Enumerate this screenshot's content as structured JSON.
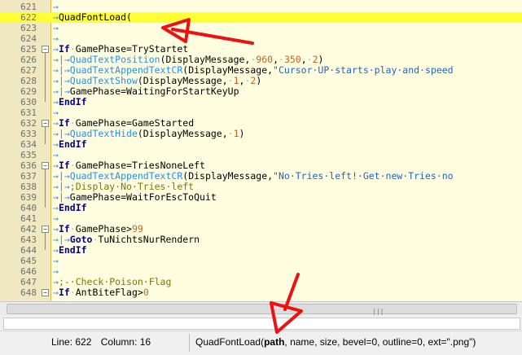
{
  "editor": {
    "current_line": 622,
    "lines": [
      {
        "num": "621",
        "tokens": [
          [
            "arrow",
            "→"
          ]
        ]
      },
      {
        "num": "622",
        "tokens": [
          [
            "arrow",
            "→"
          ],
          [
            "plain",
            "QuadFontLoad("
          ]
        ]
      },
      {
        "num": "623",
        "tokens": [
          [
            "arrow",
            "→"
          ]
        ]
      },
      {
        "num": "624",
        "tokens": [
          [
            "arrow",
            "→"
          ]
        ]
      },
      {
        "num": "625",
        "fold": "−",
        "tokens": [
          [
            "arrow",
            "→"
          ],
          [
            "kw",
            "If"
          ],
          [
            "dot",
            "·"
          ],
          [
            "plain",
            "GamePhase=TryStartet"
          ]
        ]
      },
      {
        "num": "626",
        "tokens": [
          [
            "arrow",
            "→|→"
          ],
          [
            "func",
            "QuadTextPosition"
          ],
          [
            "plain",
            "(DisplayMessage,"
          ],
          [
            "dot",
            "·"
          ],
          [
            "num",
            "960"
          ],
          [
            "plain",
            ","
          ],
          [
            "dot",
            "·"
          ],
          [
            "num",
            "350"
          ],
          [
            "plain",
            ","
          ],
          [
            "dot",
            "·"
          ],
          [
            "num",
            "2"
          ],
          [
            "plain",
            ")"
          ]
        ]
      },
      {
        "num": "627",
        "tokens": [
          [
            "arrow",
            "→|→"
          ],
          [
            "func",
            "QuadTextAppendTextCR"
          ],
          [
            "plain",
            "(DisplayMessage,"
          ],
          [
            "str",
            "\"Cursor·UP·starts·play·and·speed"
          ]
        ]
      },
      {
        "num": "628",
        "tokens": [
          [
            "arrow",
            "→|→"
          ],
          [
            "func",
            "QuadTextShow"
          ],
          [
            "plain",
            "(DisplayMessage,"
          ],
          [
            "dot",
            "·"
          ],
          [
            "num",
            "1"
          ],
          [
            "plain",
            ","
          ],
          [
            "dot",
            "·"
          ],
          [
            "num",
            "2"
          ],
          [
            "plain",
            ")"
          ]
        ]
      },
      {
        "num": "629",
        "tokens": [
          [
            "arrow",
            "→|→"
          ],
          [
            "plain",
            "GamePhase=WaitingForStartKeyUp"
          ]
        ]
      },
      {
        "num": "630",
        "tokens": [
          [
            "arrow",
            "→"
          ],
          [
            "kw",
            "EndIf"
          ]
        ]
      },
      {
        "num": "631",
        "tokens": [
          [
            "arrow",
            "→"
          ]
        ]
      },
      {
        "num": "632",
        "fold": "−",
        "tokens": [
          [
            "arrow",
            "→"
          ],
          [
            "kw",
            "If"
          ],
          [
            "dot",
            "·"
          ],
          [
            "plain",
            "GamePhase=GameStarted"
          ]
        ]
      },
      {
        "num": "633",
        "tokens": [
          [
            "arrow",
            "→|→"
          ],
          [
            "func",
            "QuadTextHide"
          ],
          [
            "plain",
            "(DisplayMessage,"
          ],
          [
            "dot",
            "·"
          ],
          [
            "num",
            "1"
          ],
          [
            "plain",
            ")"
          ]
        ]
      },
      {
        "num": "634",
        "tokens": [
          [
            "arrow",
            "→"
          ],
          [
            "kw",
            "EndIf"
          ]
        ]
      },
      {
        "num": "635",
        "tokens": [
          [
            "arrow",
            "→"
          ]
        ]
      },
      {
        "num": "636",
        "fold": "−",
        "tokens": [
          [
            "arrow",
            "→"
          ],
          [
            "kw",
            "If"
          ],
          [
            "dot",
            "·"
          ],
          [
            "plain",
            "GamePhase=TriesNoneLeft"
          ]
        ]
      },
      {
        "num": "637",
        "tokens": [
          [
            "arrow",
            "→|→"
          ],
          [
            "func",
            "QuadTextAppendTextCR"
          ],
          [
            "plain",
            "(DisplayMessage,"
          ],
          [
            "str",
            "\"No·Tries·left!·Get·new·Tries·no"
          ]
        ]
      },
      {
        "num": "638",
        "tokens": [
          [
            "arrow",
            "→|→"
          ],
          [
            "comment",
            ";Display·No·Tries·left"
          ]
        ]
      },
      {
        "num": "639",
        "tokens": [
          [
            "arrow",
            "→|→"
          ],
          [
            "plain",
            "GamePhase=WaitForEscToQuit"
          ]
        ]
      },
      {
        "num": "640",
        "tokens": [
          [
            "arrow",
            "→"
          ],
          [
            "kw",
            "EndIf"
          ]
        ]
      },
      {
        "num": "641",
        "tokens": [
          [
            "arrow",
            "→"
          ]
        ]
      },
      {
        "num": "642",
        "fold": "−",
        "tokens": [
          [
            "arrow",
            "→"
          ],
          [
            "kw",
            "If"
          ],
          [
            "dot",
            "·"
          ],
          [
            "plain",
            "GamePhase>"
          ],
          [
            "num",
            "99"
          ]
        ]
      },
      {
        "num": "643",
        "tokens": [
          [
            "arrow",
            "→|→"
          ],
          [
            "kw",
            "Goto"
          ],
          [
            "dot",
            "·"
          ],
          [
            "plain",
            "TuNichtsNurRendern"
          ]
        ]
      },
      {
        "num": "644",
        "tokens": [
          [
            "arrow",
            "→"
          ],
          [
            "kw",
            "EndIf"
          ]
        ]
      },
      {
        "num": "645",
        "tokens": [
          [
            "arrow",
            "→"
          ]
        ]
      },
      {
        "num": "646",
        "tokens": [
          [
            "arrow",
            "→"
          ]
        ]
      },
      {
        "num": "647",
        "tokens": [
          [
            "arrow",
            "→"
          ],
          [
            "comment",
            ";-·Check·Poison·Flag"
          ]
        ]
      },
      {
        "num": "648",
        "fold": "−",
        "tokens": [
          [
            "arrow",
            "→"
          ],
          [
            "kw",
            "If"
          ],
          [
            "dot",
            "·"
          ],
          [
            "plain",
            "AntBiteFlag>"
          ],
          [
            "num",
            "0"
          ]
        ]
      }
    ]
  },
  "scrollbar": {
    "grip": "|||"
  },
  "status": {
    "line_label": "Line: 622",
    "column_label": "Column: 16",
    "hint_func": "QuadFontLoad(",
    "hint_param_active": "path",
    "hint_rest": ", name, size, bevel=0, outline=0, ext=\".png\")"
  },
  "colors": {
    "current_line": "#ffff33",
    "editor_bg": "#fffde0",
    "gutter": "#f0e8c0",
    "annotation_arrow": "#ee1111"
  }
}
